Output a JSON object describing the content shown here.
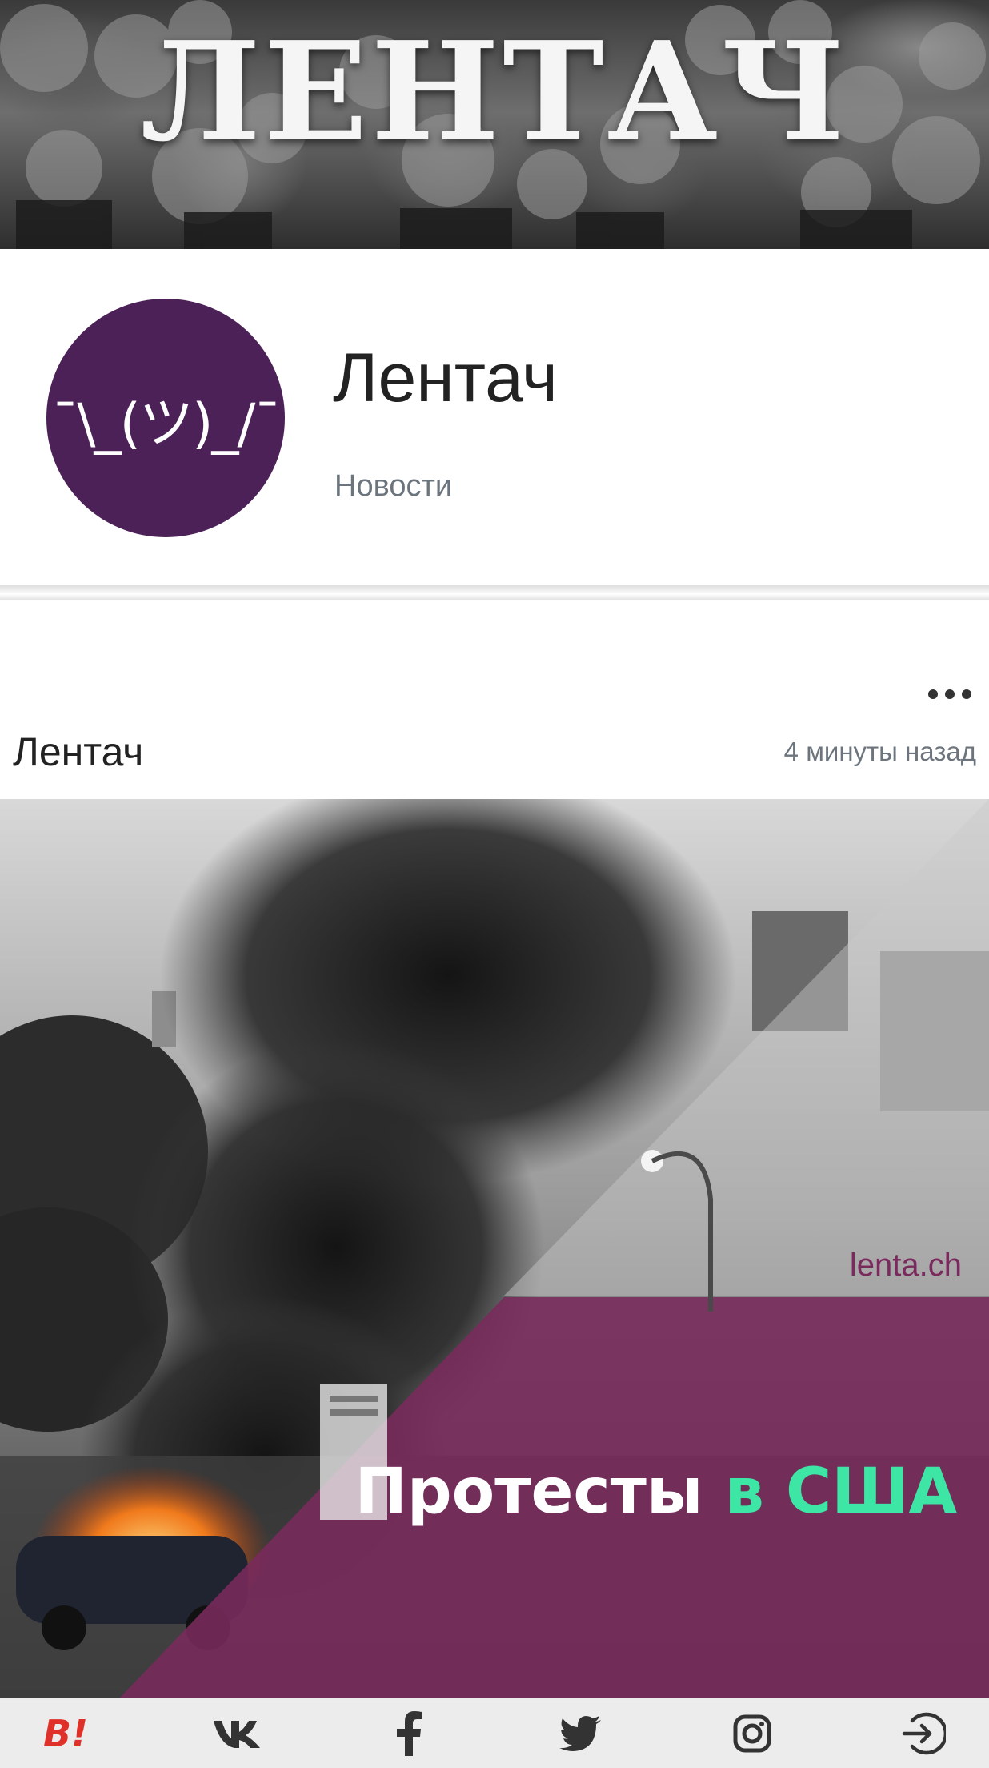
{
  "banner": {
    "title": "ЛЕНТАЧ"
  },
  "channel": {
    "avatar_text": "¯\\_(ツ)_/¯",
    "name": "Лентач",
    "category": "Новости",
    "avatar_color": "#4c2157"
  },
  "post": {
    "author": "Лентач",
    "time": "4 минуты назад",
    "image": {
      "watermark": "lenta.ch",
      "headline_main": "Протесты",
      "headline_accent": "в США",
      "accent_color": "#3ee6a6",
      "panel_color": "#7a2a5c"
    }
  },
  "bottom_bar": {
    "brand_label": "B!",
    "items": [
      "vk-icon",
      "facebook-icon",
      "twitter-icon",
      "instagram-icon",
      "login-icon"
    ]
  }
}
